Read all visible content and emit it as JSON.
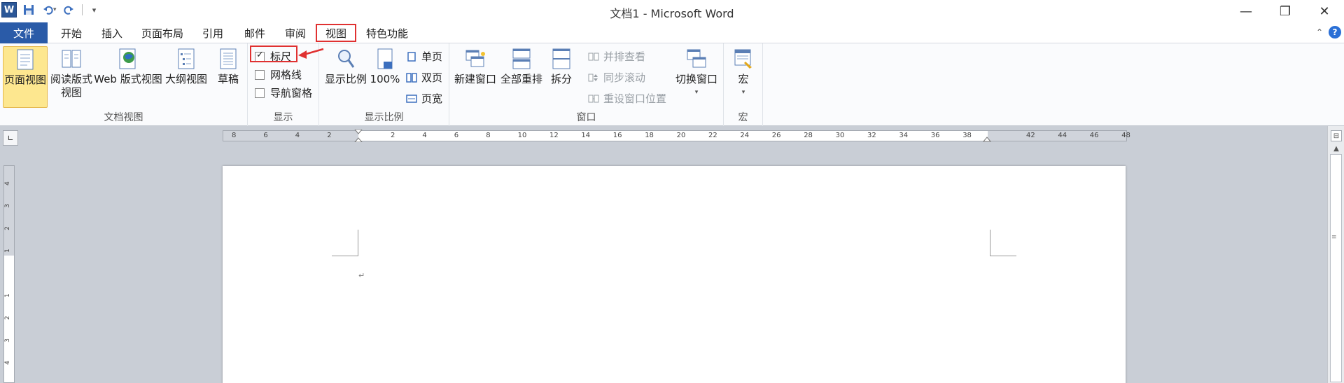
{
  "titlebar": {
    "title": "文档1 - Microsoft Word",
    "app_icon_letter": "W",
    "qat": [
      {
        "name": "save-icon",
        "label": "💾"
      },
      {
        "name": "undo-icon",
        "label": "↶"
      },
      {
        "name": "redo-icon",
        "label": "↷"
      }
    ],
    "window_controls": [
      "—",
      "❐",
      "✕"
    ]
  },
  "tabs": {
    "file": "文件",
    "items": [
      "开始",
      "插入",
      "页面布局",
      "引用",
      "邮件",
      "审阅",
      "视图",
      "特色功能"
    ],
    "active": "视图"
  },
  "ribbon": {
    "doc_views": {
      "label": "文档视图",
      "buttons": [
        "页面视图",
        "阅读版式\n视图",
        "Web 版式视图",
        "大纲视图",
        "草稿"
      ]
    },
    "show": {
      "label": "显示",
      "items": [
        {
          "label": "标尺",
          "checked": true
        },
        {
          "label": "网格线",
          "checked": false
        },
        {
          "label": "导航窗格",
          "checked": false
        }
      ]
    },
    "zoom": {
      "label": "显示比例",
      "zoom_btn": "显示比例",
      "pct_btn": "100%",
      "small": [
        "单页",
        "双页",
        "页宽"
      ]
    },
    "window": {
      "label": "窗口",
      "buttons": [
        "新建窗口",
        "全部重排",
        "拆分"
      ],
      "small": [
        "并排查看",
        "同步滚动",
        "重设窗口位置"
      ],
      "switch": "切换窗口"
    },
    "macro": {
      "label": "宏",
      "button": "宏"
    }
  },
  "ruler": {
    "h_labels": [
      "8",
      "6",
      "4",
      "2",
      "",
      "2",
      "4",
      "6",
      "8",
      "10",
      "12",
      "14",
      "16",
      "18",
      "20",
      "22",
      "24",
      "26",
      "28",
      "30",
      "32",
      "34",
      "36",
      "38",
      "",
      "42",
      "44",
      "46",
      "48"
    ],
    "v_labels": [
      "4",
      "3",
      "2",
      "1",
      "",
      "1",
      "2",
      "3",
      "4"
    ]
  },
  "document": {
    "paragraph_mark": "↵"
  },
  "colors": {
    "file_tab": "#2a5ba8",
    "highlight": "#e03131",
    "selected_button": "#fde78f"
  }
}
